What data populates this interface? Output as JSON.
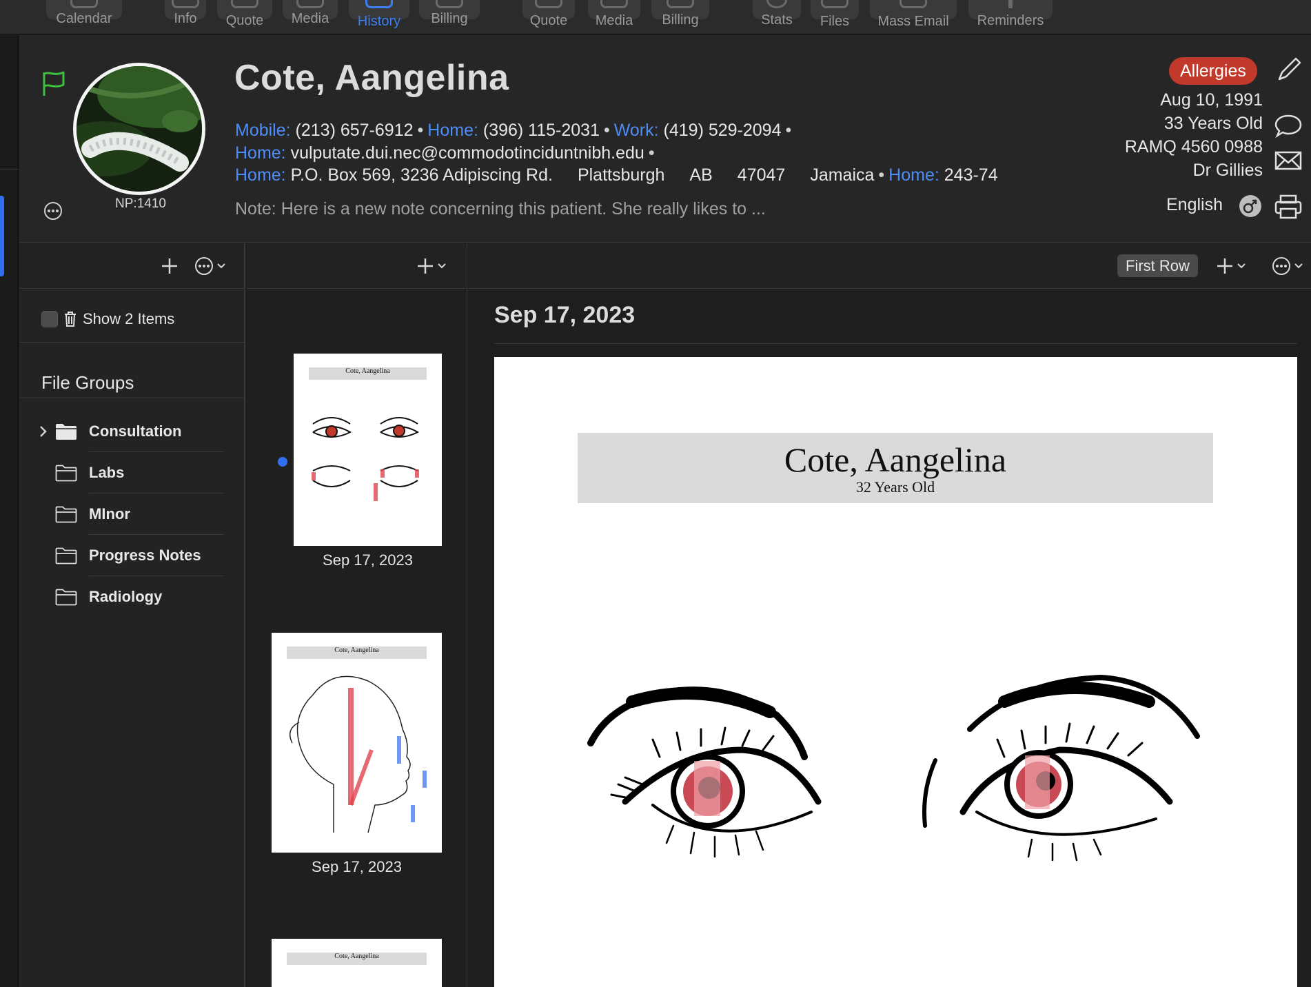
{
  "toolbar": {
    "items": [
      {
        "label": "Calendar",
        "icon": "calendar-icon"
      },
      {
        "label": "Info",
        "icon": "person-icon"
      },
      {
        "label": "Quote",
        "icon": "quote-bubble-icon"
      },
      {
        "label": "Media",
        "icon": "media-icon"
      },
      {
        "label": "History",
        "icon": "history-icon",
        "active": true
      },
      {
        "label": "Billing",
        "icon": "billing-icon"
      },
      {
        "label": "Quote",
        "icon": "quote-bubble-icon"
      },
      {
        "label": "Media",
        "icon": "media-icon"
      },
      {
        "label": "Billing",
        "icon": "billing-icon"
      },
      {
        "label": "Stats",
        "icon": "stats-pie-icon"
      },
      {
        "label": "Files",
        "icon": "files-icon"
      },
      {
        "label": "Mass Email",
        "icon": "mail-icon"
      },
      {
        "label": "Reminders",
        "icon": "reminders-icon"
      }
    ]
  },
  "patient": {
    "name": "Cote, Aangelina",
    "np": "NP:1410",
    "mobile_label": "Mobile:",
    "mobile": "(213) 657-6912",
    "home_label": "Home:",
    "home_phone": "(396) 115-2031",
    "work_label": "Work:",
    "work_phone": "(419) 529-2094",
    "email_label": "Home:",
    "email": "vulputate.dui.nec@commodotinciduntnibh.edu",
    "address_label": "Home:",
    "address_street": "P.O. Box 569, 3236 Adipiscing Rd.",
    "address_city": "Plattsburgh",
    "address_province": "AB",
    "address_postal": "47047",
    "address_country": "Jamaica",
    "extra_label": "Home:",
    "extra_value": "243-74",
    "note": "Note: Here is a new note concerning this patient. She really likes to ...",
    "allergies": "Allergies",
    "dob": "Aug 10, 1991",
    "age": "33 Years Old",
    "ramq": "RAMQ 4560 0988",
    "doctor": "Dr Gillies",
    "language": "English"
  },
  "colbars": {
    "first_row": "First Row"
  },
  "sidebar": {
    "show_items": "Show 2 Items",
    "file_groups_title": "File Groups",
    "groups": [
      {
        "label": "Consultation",
        "expandable": true
      },
      {
        "label": "Labs"
      },
      {
        "label": "MInor"
      },
      {
        "label": "Progress Notes"
      },
      {
        "label": "Radiology"
      }
    ]
  },
  "thumbnails": [
    {
      "date": "Sep 17, 2023",
      "title": "Cote, Aangelina",
      "selected": true
    },
    {
      "date": "Sep 17, 2023",
      "title": "Cote, Aangelina"
    },
    {
      "date": "",
      "title": "Cote, Aangelina"
    }
  ],
  "document": {
    "date": "Sep 17, 2023",
    "header_name": "Cote, Aangelina",
    "header_age": "32 Years Old"
  },
  "colors": {
    "accent_blue": "#3b7ff2",
    "label_blue": "#4d8df7",
    "allergy_red": "#c0392b",
    "flag_green": "#3fbf3f",
    "markup_red": "#e0454f",
    "markup_blue": "#4d7ef0"
  }
}
